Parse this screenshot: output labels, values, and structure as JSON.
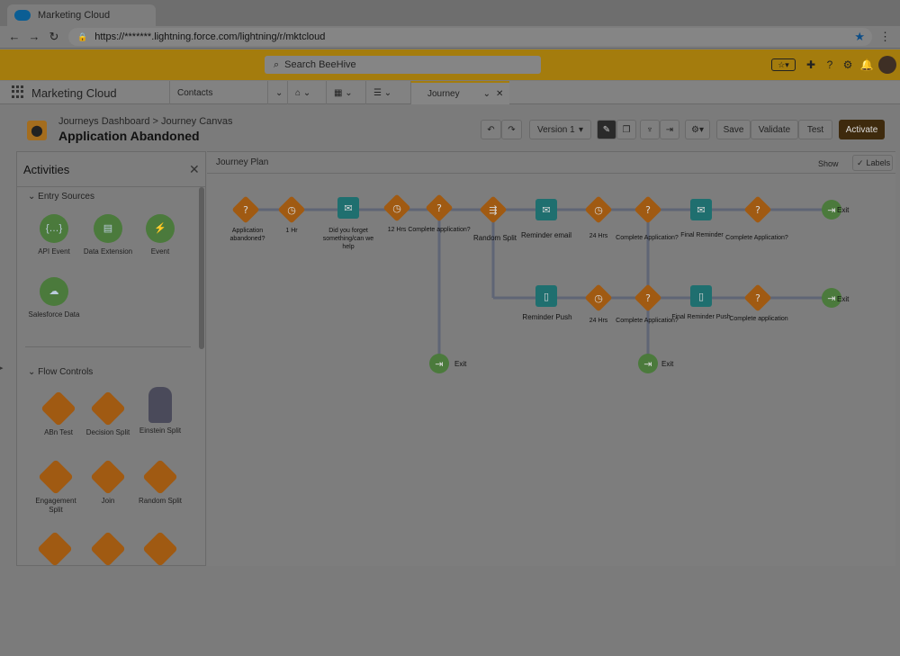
{
  "browser": {
    "tab_title": "Marketing Cloud",
    "url": "https://*******.lightning.force.com/lightning/r/mktcloud"
  },
  "header": {
    "search_placeholder": "Search BeeHive"
  },
  "nav": {
    "app_name": "Marketing Cloud",
    "items": [
      {
        "label": "Contacts"
      },
      {
        "label": ""
      },
      {
        "label": ""
      },
      {
        "label": ""
      },
      {
        "label": "Journey"
      }
    ]
  },
  "page": {
    "breadcrumb": "Journeys Dashboard > Journey Canvas",
    "title": "Application Abandoned",
    "version": "Version 1",
    "buttons": {
      "save": "Save",
      "validate": "Validate",
      "test": "Test",
      "activate": "Activate"
    }
  },
  "activities": {
    "title": "Activities",
    "entry_sources_title": "Entry Sources",
    "entry_sources": [
      "API Event",
      "Data Extension",
      "Event",
      "Salesforce Data"
    ],
    "flow_controls_title": "Flow Controls",
    "flow_controls": [
      "ABn Test",
      "Decision Split",
      "Einstein Split",
      "Engagement Split",
      "Join",
      "Random Split"
    ]
  },
  "canvas": {
    "title": "Journey Plan",
    "show_label": "Show",
    "labels_label": "Labels",
    "nodes": [
      {
        "label": "Application abandoned?",
        "type": "decision"
      },
      {
        "label": "1 Hr",
        "type": "wait"
      },
      {
        "label": "Did you forget something/can we help",
        "type": "email"
      },
      {
        "label": "12 Hrs",
        "type": "wait"
      },
      {
        "label": "Complete application?",
        "type": "decision"
      },
      {
        "label": "Random Split",
        "type": "split"
      },
      {
        "label": "Reminder email",
        "type": "email"
      },
      {
        "label": "24 Hrs",
        "type": "wait"
      },
      {
        "label": "Complete Application?",
        "type": "decision"
      },
      {
        "label": "Final Reminder",
        "type": "email"
      },
      {
        "label": "Complete Application?",
        "type": "decision"
      },
      {
        "label": "Exit",
        "type": "exit"
      },
      {
        "label": "Reminder Push",
        "type": "push"
      },
      {
        "label": "24 Hrs",
        "type": "wait"
      },
      {
        "label": "Complete Application?",
        "type": "decision"
      },
      {
        "label": "Final Reminder Push",
        "type": "push"
      },
      {
        "label": "Complete application",
        "type": "decision"
      },
      {
        "label": "Exit",
        "type": "exit"
      },
      {
        "label": "Exit",
        "type": "exit"
      },
      {
        "label": "Exit",
        "type": "exit"
      }
    ]
  },
  "colors": {
    "decision": "#a05a12",
    "activity": "#1f6f6f",
    "exit": "#4b7a3c",
    "path": "#5f6575",
    "brand_bar": "#a47c0d"
  }
}
